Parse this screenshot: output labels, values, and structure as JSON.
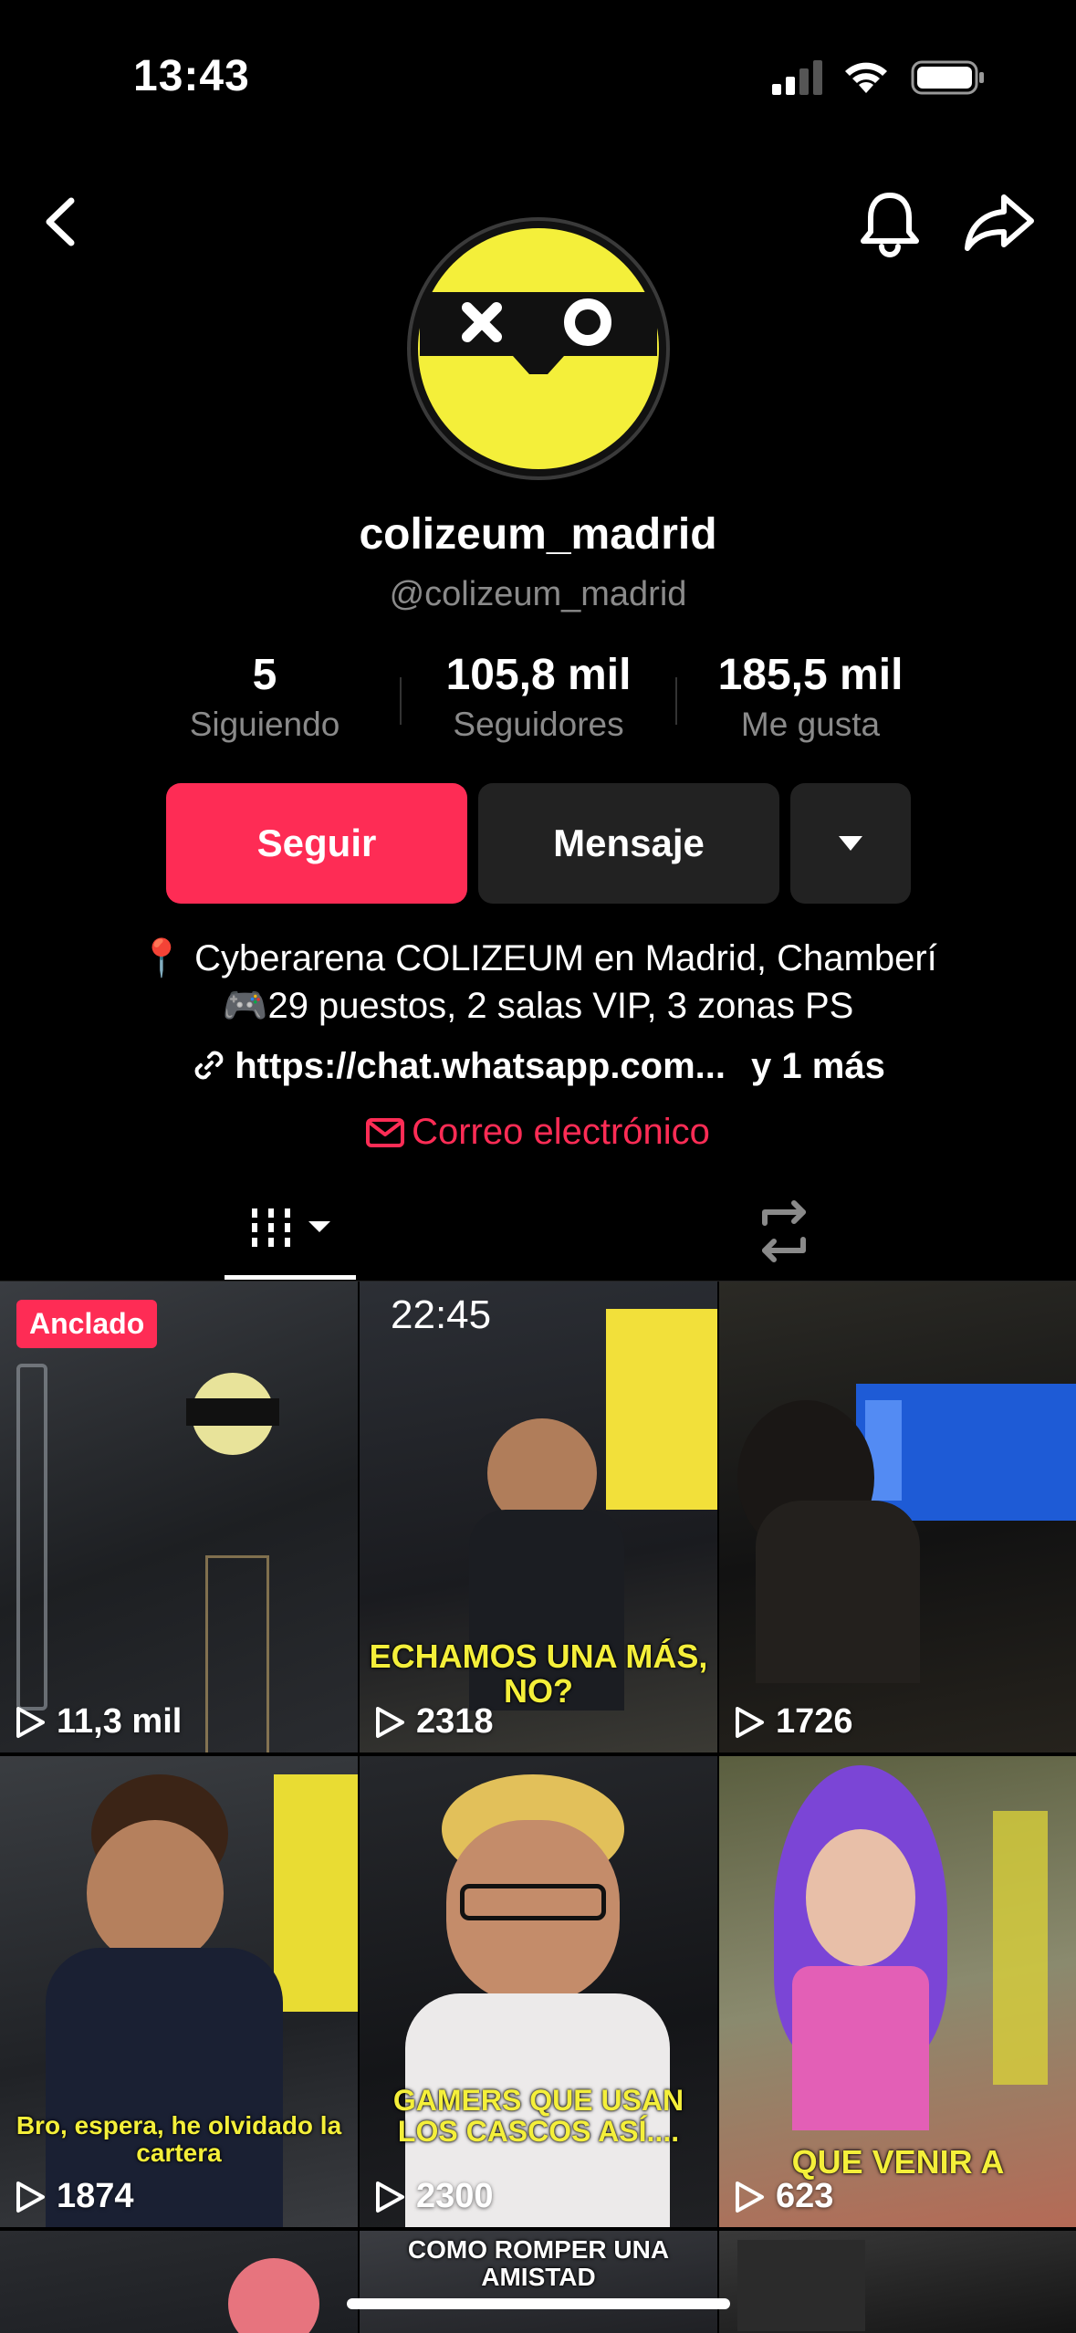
{
  "status": {
    "time": "13:43"
  },
  "profile": {
    "name": "colizeum_madrid",
    "handle": "@colizeum_madrid",
    "stats": [
      {
        "value": "5",
        "label": "Siguiendo"
      },
      {
        "value": "105,8 mil",
        "label": "Seguidores"
      },
      {
        "value": "185,5 mil",
        "label": "Me gusta"
      }
    ],
    "buttons": {
      "follow": "Seguir",
      "message": "Mensaje"
    },
    "bio": [
      "📍 Cyberarena COLIZEUM en Madrid, Chamberí",
      "🎮29 puestos, 2 salas VIP, 3 zonas PS"
    ],
    "link": "https://chat.whatsapp.com...",
    "link_more": "y 1 más",
    "email_label": "Correo electrónico"
  },
  "videos": [
    {
      "views": "11,3 mil",
      "pinned": "Anclado",
      "caption": ""
    },
    {
      "views": "2318",
      "overlay_time": "22:45",
      "caption": "ECHAMOS UNA MÁS, NO?"
    },
    {
      "views": "1726",
      "caption": ""
    },
    {
      "views": "1874",
      "caption": "Bro, espera, he olvidado la cartera"
    },
    {
      "views": "2300",
      "caption": "GAMERS QUE USAN LOS CASCOS ASÍ...."
    },
    {
      "views": "623",
      "caption": "QUE VENIR A"
    },
    {
      "views": "",
      "caption": ""
    },
    {
      "views": "",
      "caption": "COMO ROMPER UNA AMISTAD"
    },
    {
      "views": "",
      "caption": ""
    }
  ],
  "colors": {
    "accent": "#fe2c55",
    "brand_yellow": "#f4ef3a"
  },
  "icons": [
    "back-arrow-icon",
    "bell-icon",
    "share-icon",
    "chevron-down-icon",
    "link-icon",
    "mail-icon",
    "grid-icon",
    "repost-icon",
    "play-icon"
  ]
}
